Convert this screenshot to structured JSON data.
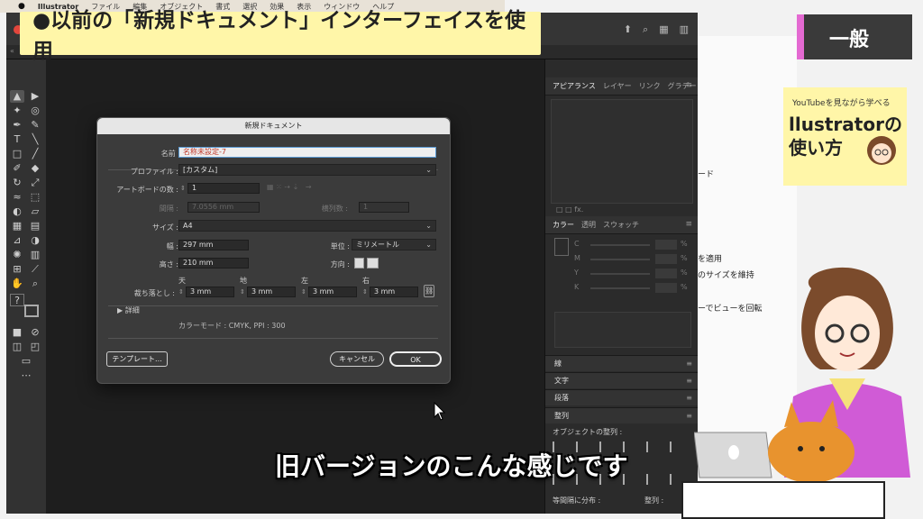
{
  "menubar": {
    "app": "Illustrator",
    "items": [
      "ファイル",
      "編集",
      "オブジェクト",
      "書式",
      "選択",
      "効果",
      "表示",
      "ウィンドウ",
      "ヘルプ"
    ]
  },
  "banner": {
    "text": "●以前の「新規ドキュメント」インターフェイスを使用"
  },
  "subtitle": {
    "text": "旧バージョンのこんな感じです"
  },
  "category": {
    "text": "一般"
  },
  "book": {
    "small": "YouTubeを見ながら学べる",
    "title": "llustratorの\n使い方"
  },
  "side_text": {
    "t1": "ード",
    "t2": "を適用",
    "t3": "のサイズを維持",
    "t4": "ーでビューを回転"
  },
  "panels": {
    "appearance_tabs": [
      "アピアランス",
      "レイヤー",
      "リンク",
      "グラデー"
    ],
    "color_tabs": [
      "カラー",
      "透明",
      "スウォッチ"
    ],
    "cmyk": [
      "C",
      "M",
      "Y",
      "K"
    ],
    "percent": "%",
    "stroke": "線",
    "type": "文字",
    "paragraph": "段落",
    "align": "整列",
    "align_objects": "オブジェクトの整列 :",
    "distribute_spacing": "等間隔に分布 :",
    "align_to": "整列 :"
  },
  "dialog": {
    "title": "新規ドキュメント",
    "name_label": "名前 :",
    "name_value": "名称未設定-7",
    "profile_label": "プロファイル :",
    "profile_value": "[カスタム]",
    "artboards_label": "アートボードの数 :",
    "artboards_value": "1",
    "spacing_label": "間隔 :",
    "spacing_value": "7.0556 mm",
    "columns_label": "横列数 :",
    "columns_value": "1",
    "size_label": "サイズ :",
    "size_value": "A4",
    "width_label": "幅 :",
    "width_value": "297 mm",
    "units_label": "単位 :",
    "units_value": "ミリメートル",
    "height_label": "高さ :",
    "height_value": "210 mm",
    "orientation_label": "方向 :",
    "bleed_label": "裁ち落とし :",
    "bleed_top_label": "天",
    "bleed_bottom_label": "地",
    "bleed_left_label": "左",
    "bleed_right_label": "右",
    "bleed_top": "3 mm",
    "bleed_bottom": "3 mm",
    "bleed_left": "3 mm",
    "bleed_right": "3 mm",
    "advanced_label": "詳細",
    "color_mode": "カラーモード : CMYK, PPI : 300",
    "template_button": "テンプレート...",
    "cancel_button": "キャンセル",
    "ok_button": "OK"
  }
}
